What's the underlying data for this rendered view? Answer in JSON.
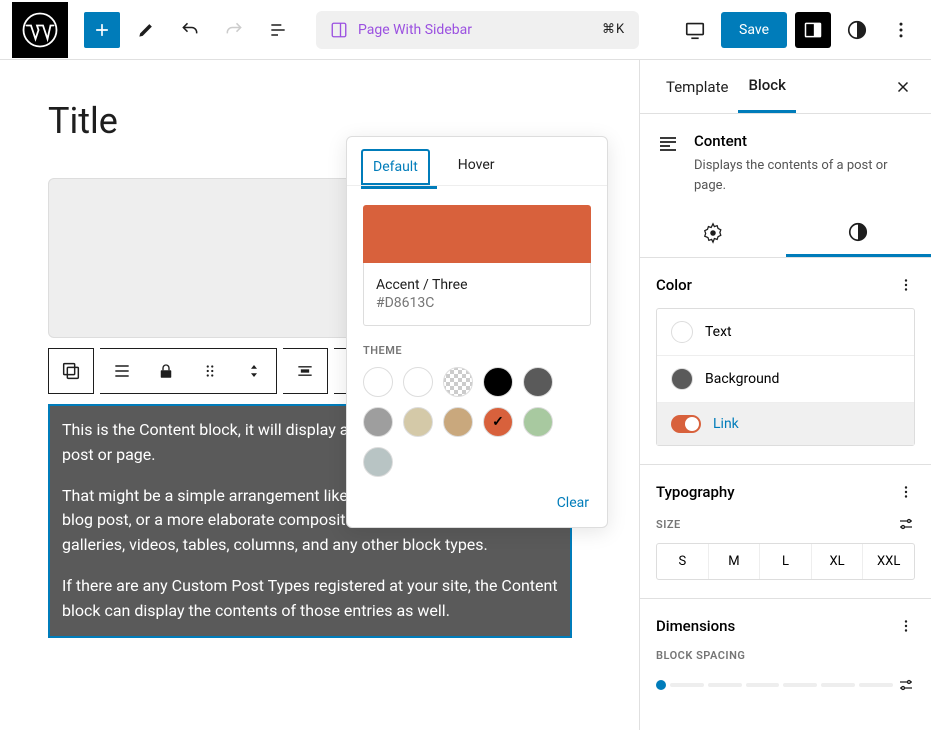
{
  "topbar": {
    "page_title": "Page With Sidebar",
    "keyboard_shortcut": "⌘K",
    "save_label": "Save"
  },
  "editor": {
    "title": "Title",
    "content_paragraphs": [
      "This is the Content block, it will display all the blocks in any single post or page.",
      "That might be a simple arrangement like consecutive paragraphs in a blog post, or a more elaborate composition that includes image galleries, videos, tables, columns, and any other block types.",
      "If there are any Custom Post Types registered at your site, the Content block can display the contents of those entries as well."
    ]
  },
  "popover": {
    "tabs": {
      "default": "Default",
      "hover": "Hover"
    },
    "swatch_name": "Accent / Three",
    "swatch_hex": "#D8613C",
    "theme_label": "THEME",
    "theme_colors": [
      "#ffffff",
      "#ffffff",
      "checker",
      "#000000",
      "#5a5a5a",
      "#9e9e9e",
      "#d4c9a8",
      "#c9a87d",
      "#D8613C",
      "#a8c9a0",
      "#b8c4c4"
    ],
    "selected_color_index": 8,
    "clear_label": "Clear"
  },
  "sidebar": {
    "tabs": {
      "template": "Template",
      "block": "Block"
    },
    "block_header": {
      "title": "Content",
      "description": "Displays the contents of a post or page."
    },
    "color": {
      "panel_title": "Color",
      "rows": {
        "text": "Text",
        "background": "Background",
        "link": "Link"
      },
      "link_color": "#D8613C",
      "bg_color": "#5a5a5a"
    },
    "typography": {
      "panel_title": "Typography",
      "size_label": "SIZE",
      "sizes": [
        "S",
        "M",
        "L",
        "XL",
        "XXL"
      ]
    },
    "dimensions": {
      "panel_title": "Dimensions",
      "spacing_label": "BLOCK SPACING"
    }
  }
}
